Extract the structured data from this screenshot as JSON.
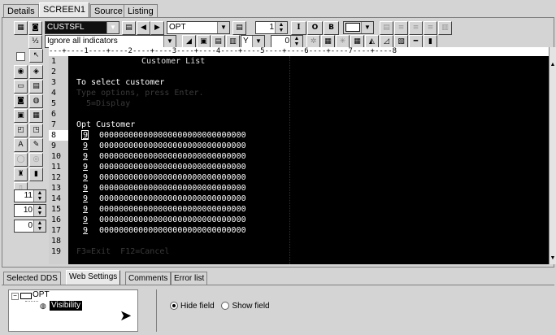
{
  "tabs_top": [
    {
      "label": "Details"
    },
    {
      "label": "SCREEN1"
    },
    {
      "label": "Source"
    },
    {
      "label": "Listing"
    }
  ],
  "toolbar": {
    "record_combo": "CUSTSFL",
    "field_combo": "OPT",
    "indicator_combo": "Ignore all indicators",
    "y_combo": "Y",
    "spin1": "1",
    "spin2": "0",
    "font_i": "I",
    "font_o": "O",
    "font_b": "B"
  },
  "left_spins": [
    "11",
    "10",
    "0"
  ],
  "editor": {
    "ruler": "---+----1----+----2----+----3----+----4----+----5----+----6----+----7----+----8",
    "line_numbers": [
      "1",
      "2",
      "3",
      "4",
      "5",
      "6",
      "7",
      "8",
      "9",
      "10",
      "11",
      "12",
      "13",
      "14",
      "15",
      "16",
      "17",
      "18",
      "19"
    ],
    "title": "Customer List",
    "line2": "",
    "line3": "To select customer",
    "line4": "Type options, press Enter.",
    "line5": "  5=Display",
    "header": "Opt Customer",
    "opt_values": [
      "9",
      "9",
      "9",
      "9",
      "9",
      "9",
      "9",
      "9",
      "9",
      "9"
    ],
    "customer_values": [
      "000000000000000000000000000000",
      "000000000000000000000000000000",
      "000000000000000000000000000000",
      "000000000000000000000000000000",
      "000000000000000000000000000000",
      "000000000000000000000000000000",
      "000000000000000000000000000000",
      "000000000000000000000000000000",
      "000000000000000000000000000000",
      "000000000000000000000000000000"
    ],
    "line19": "F3=Exit  F12=Cancel"
  },
  "bottom_tabs": [
    {
      "label": "Selected DDS"
    },
    {
      "label": "Web Settings"
    },
    {
      "label": "Comments"
    },
    {
      "label": "Error list"
    }
  ],
  "tree": {
    "root": "OPT",
    "child": "Visibility"
  },
  "visibility": {
    "hide_label": "Hide field",
    "show_label": "Show field",
    "selected": "hide"
  }
}
